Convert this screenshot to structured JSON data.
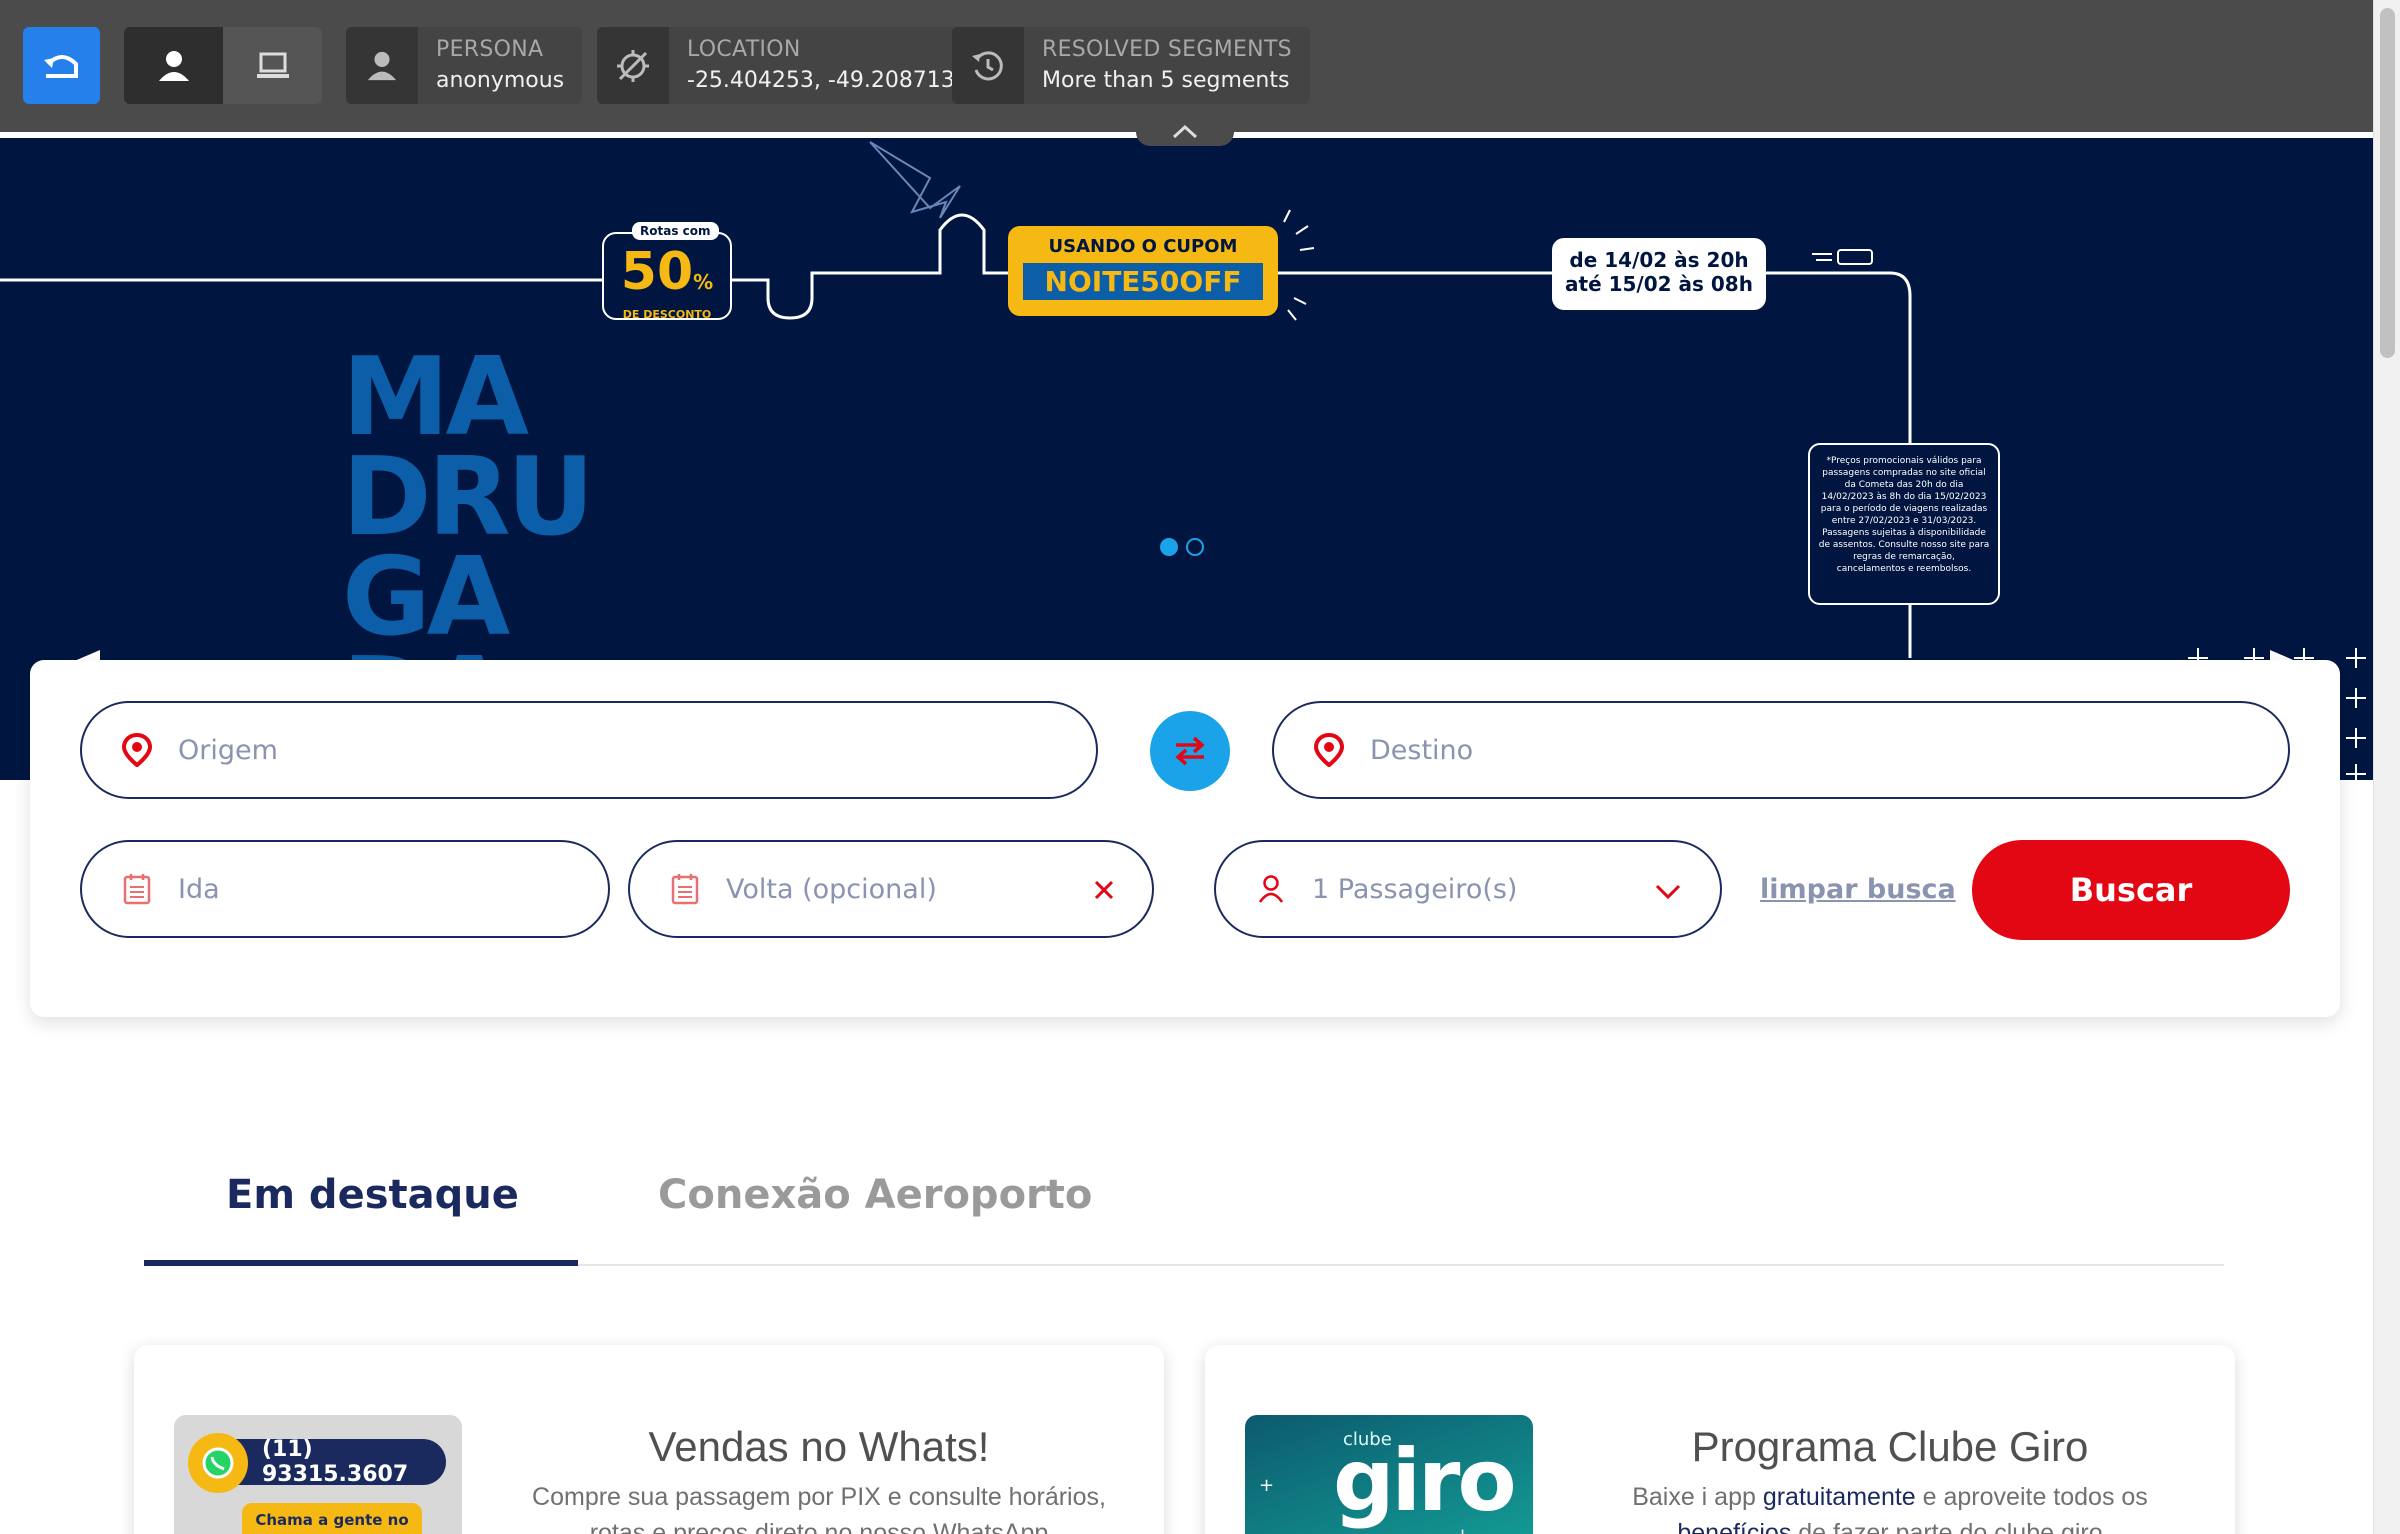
{
  "toolbar": {
    "persona": {
      "label": "PERSONA",
      "value": "anonymous"
    },
    "location": {
      "label": "LOCATION",
      "value": "-25.404253, -49.208713"
    },
    "segments": {
      "label": "RESOLVED SEGMENTS",
      "value": "More than 5 segments"
    },
    "accent_color": "#2680eb"
  },
  "hero": {
    "headline": "MADRUGADA",
    "badge_top": "Rotas com",
    "badge_number": "50",
    "badge_percent": "%",
    "badge_sub": "DE DESCONTO",
    "coupon_prefix": "USANDO O CUPOM",
    "coupon_code": "NOITE50OFF",
    "date_line1": "de 14/02 às 20h",
    "date_line2": "até 15/02 às 08h",
    "fineprint": "*Preços promocionais válidos para passagens compradas no site oficial da Cometa das 20h do dia 14/02/2023 às 8h do dia 15/02/2023 para o período de viagens realizadas entre 27/02/2023 e 31/03/2023. Passagens sujeitas à disponibilidade de assentos. Consulte nosso site para regras de remarcação, cancelamentos e reembolsos.",
    "slide_count": 2,
    "active_slide": 1,
    "bg_color": "#001640"
  },
  "search": {
    "origin_placeholder": "Origem",
    "destination_placeholder": "Destino",
    "departure_placeholder": "Ida",
    "return_placeholder": "Volta (opcional)",
    "passengers_value": "1 Passageiro(s)",
    "clear_label": "limpar busca",
    "submit_label": "Buscar",
    "submit_color": "#e30613"
  },
  "tabs": [
    {
      "label": "Em destaque",
      "active": true
    },
    {
      "label": "Conexão Aeroporto",
      "active": false
    }
  ],
  "cards": [
    {
      "title": "Vendas no Whats!",
      "desc_line1": "Compre sua passagem por PIX e consulte horários,",
      "desc_line2": "rotas e preços direto no nosso WhatsApp",
      "thumb_phone": "(11) 93315.3607",
      "thumb_caption": "Chama a gente no"
    },
    {
      "title": "Programa Clube Giro",
      "desc_pre": "Baixe i app ",
      "desc_hl1": "gratuitamente",
      "desc_mid": " e aproveite todos os",
      "desc_hl2": "benefícios",
      "desc_post": " de fazer parte do clube giro",
      "thumb_small": "clube",
      "thumb_big": "giro"
    }
  ]
}
